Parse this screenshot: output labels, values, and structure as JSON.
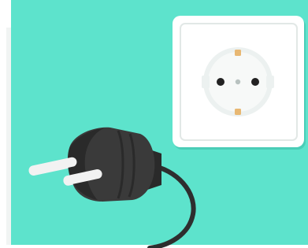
{
  "scene": {
    "subject": "plug-and-socket-illustration",
    "colors": {
      "background": "#5DE3CC",
      "frame": "#FFFFFF",
      "socket_plate": "#FFFFFF",
      "socket_plate_border": "#E2E8E6",
      "socket_face": "#F3F6F5",
      "socket_holes": "#222222",
      "socket_ground_clips": "#E8B873",
      "plug_body": "#3A3A3A",
      "plug_body_dark": "#2A2A2A",
      "plug_pins": "#F2F2F2",
      "cable": "#2E2E2E"
    }
  }
}
